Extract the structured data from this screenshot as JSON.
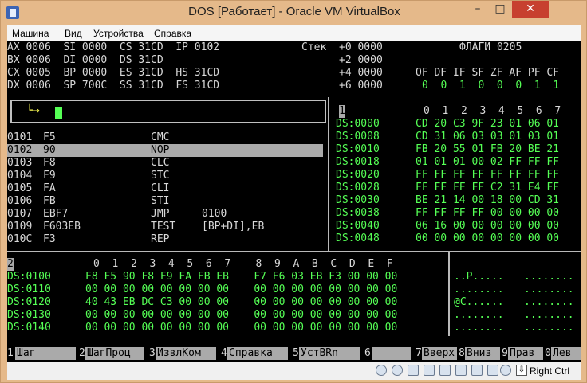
{
  "window": {
    "title": "DOS [Работает] - Oracle VM VirtualBox",
    "min_glyph": "–",
    "max_glyph": "□",
    "close_glyph": "✕"
  },
  "menu": [
    "Машина",
    "Вид",
    "Устройства",
    "Справка"
  ],
  "registers": {
    "row1": "AX 0006  SI 0000  CS 31CD  IP 0102",
    "row2": "BX 0006  DI 0000  DS 31CD",
    "row3": "CX 0005  BP 0000  ES 31CD  HS 31CD",
    "row4": "DX 0006  SP 700C  SS 31CD  FS 31CD"
  },
  "stack": {
    "title": "Стек",
    "rows": [
      "+0 0000",
      "+2 0000",
      "+4 0000",
      "+6 0000"
    ]
  },
  "flags": {
    "title": "ФЛАГИ 0205",
    "names": "OF DF IF SF ZF AF PF CF",
    "values": "0  0  1  0  0  0  1  1"
  },
  "command_prompt": {
    "arrow": "└→"
  },
  "disasm": [
    {
      "addr": "0101",
      "bytes": "F5",
      "mnem": "CMC",
      "ops": ""
    },
    {
      "addr": "0102",
      "bytes": "90",
      "mnem": "NOP",
      "ops": ""
    },
    {
      "addr": "0103",
      "bytes": "F8",
      "mnem": "CLC",
      "ops": ""
    },
    {
      "addr": "0104",
      "bytes": "F9",
      "mnem": "STC",
      "ops": ""
    },
    {
      "addr": "0105",
      "bytes": "FA",
      "mnem": "CLI",
      "ops": ""
    },
    {
      "addr": "0106",
      "bytes": "FB",
      "mnem": "STI",
      "ops": ""
    },
    {
      "addr": "0107",
      "bytes": "EBF7",
      "mnem": "JMP",
      "ops": "0100"
    },
    {
      "addr": "0109",
      "bytes": "F603EB",
      "mnem": "TEST",
      "ops": "[BP+DI],EB"
    },
    {
      "addr": "010C",
      "bytes": "F3",
      "mnem": "REP",
      "ops": ""
    }
  ],
  "dump1": {
    "window_num": "1",
    "header": "0  1  2  3  4  5  6  7",
    "rows": [
      {
        "seg": "DS:0000",
        "hex": "CD 20 C3 9F 23 01 06 01"
      },
      {
        "seg": "DS:0008",
        "hex": "CD 31 06 03 03 01 03 01"
      },
      {
        "seg": "DS:0010",
        "hex": "FB 20 55 01 FB 20 BE 21"
      },
      {
        "seg": "DS:0018",
        "hex": "01 01 01 00 02 FF FF FF"
      },
      {
        "seg": "DS:0020",
        "hex": "FF FF FF FF FF FF FF FF"
      },
      {
        "seg": "DS:0028",
        "hex": "FF FF FF FF C2 31 E4 FF"
      },
      {
        "seg": "DS:0030",
        "hex": "BE 21 14 00 18 00 CD 31"
      },
      {
        "seg": "DS:0038",
        "hex": "FF FF FF FF 00 00 00 00"
      },
      {
        "seg": "DS:0040",
        "hex": "06 16 00 00 00 00 00 00"
      },
      {
        "seg": "DS:0048",
        "hex": "00 00 00 00 00 00 00 00"
      }
    ]
  },
  "dump2": {
    "window_num": "2",
    "header": "0  1  2  3  4  5  6  7    8  9  A  B  C  D  E  F",
    "rows": [
      {
        "seg": "DS:0100",
        "hex": "F8 F5 90 F8 F9 FA FB EB    F7 F6 03 EB F3 00 00 00",
        "ascii1": "..P.....",
        "ascii2": "........"
      },
      {
        "seg": "DS:0110",
        "hex": "00 00 00 00 00 00 00 00    00 00 00 00 00 00 00 00",
        "ascii1": "........",
        "ascii2": "........"
      },
      {
        "seg": "DS:0120",
        "hex": "40 43 EB DC C3 00 00 00    00 00 00 00 00 00 00 00",
        "ascii1": "@C......",
        "ascii2": "........"
      },
      {
        "seg": "DS:0130",
        "hex": "00 00 00 00 00 00 00 00    00 00 00 00 00 00 00 00",
        "ascii1": "........",
        "ascii2": "........"
      },
      {
        "seg": "DS:0140",
        "hex": "00 00 00 00 00 00 00 00    00 00 00 00 00 00 00 00",
        "ascii1": "........",
        "ascii2": "........"
      }
    ]
  },
  "fkeys": [
    {
      "num": "1",
      "label": "Шаг"
    },
    {
      "num": "2",
      "label": "ШагПроц"
    },
    {
      "num": "3",
      "label": "ИзвлКом"
    },
    {
      "num": "4",
      "label": "Справка"
    },
    {
      "num": "5",
      "label": "УстВRn"
    },
    {
      "num": "6",
      "label": ""
    },
    {
      "num": "7",
      "label": "Вверх"
    },
    {
      "num": "8",
      "label": "Вниз"
    },
    {
      "num": "9",
      "label": "Прав"
    },
    {
      "num": "0",
      "label": "Лев"
    }
  ],
  "statusbar": {
    "host_key": "Right Ctrl",
    "arrow_glyph": "⇩"
  }
}
